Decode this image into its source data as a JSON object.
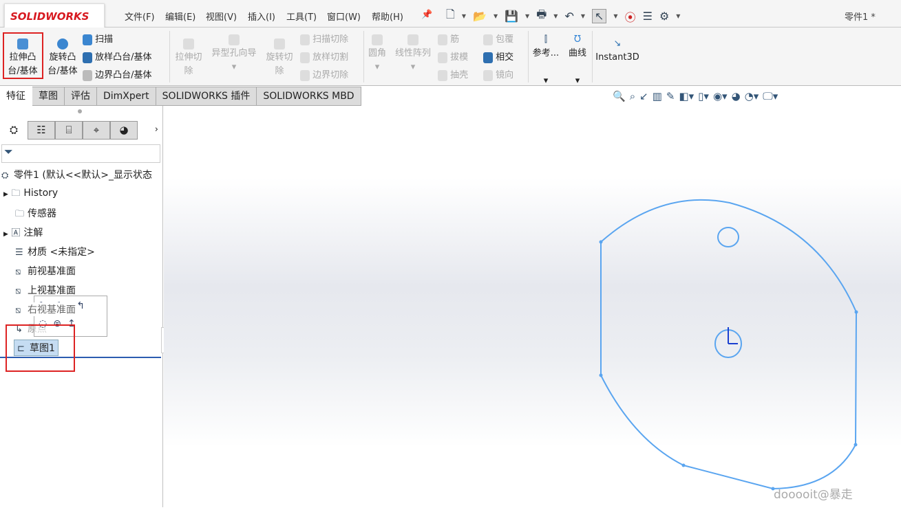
{
  "app": {
    "logo": "SOLIDWORKS",
    "doc_title": "零件1 *"
  },
  "menu": [
    "文件(F)",
    "编辑(E)",
    "视图(V)",
    "插入(I)",
    "工具(T)",
    "窗口(W)",
    "帮助(H)"
  ],
  "ribbon": {
    "extrude_boss": [
      "拉伸凸",
      "台/基体"
    ],
    "revolve_boss": [
      "旋转凸",
      "台/基体"
    ],
    "sweep": "扫描",
    "loft": "放样凸台/基体",
    "boundary": "边界凸台/基体",
    "extrude_cut": [
      "拉伸切",
      "除"
    ],
    "hole_wizard": "异型孔向导",
    "revolve_cut": [
      "旋转切",
      "除"
    ],
    "sweep_cut": "扫描切除",
    "loft_cut": "放样切割",
    "boundary_cut": "边界切除",
    "fillet": "圆角",
    "linear_pattern": "线性阵列",
    "rib": "筋",
    "wrap": "包覆",
    "draft": "拔模",
    "intersect": "相交",
    "shell": "抽壳",
    "mirror": "镜向",
    "reference": "参考...",
    "curves": "曲线",
    "instant3d": "Instant3D"
  },
  "tabs": [
    "特征",
    "草图",
    "评估",
    "DimXpert",
    "SOLIDWORKS 插件",
    "SOLIDWORKS MBD"
  ],
  "tree": {
    "root": "零件1  (默认<<默认>_显示状态",
    "items": [
      "History",
      "传感器",
      "注解",
      "材质 <未指定>",
      "前视基准面",
      "上视基准面",
      "右视基准面",
      "原点",
      "草图1"
    ]
  },
  "watermark": "dooooit@暴走",
  "colors": {
    "sketch": "#5aa5f0",
    "highlight": "#d22222"
  }
}
